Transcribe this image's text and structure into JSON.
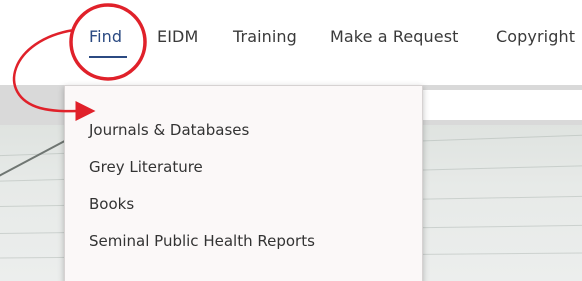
{
  "nav": {
    "items": [
      {
        "label": "Find",
        "active": true
      },
      {
        "label": "EIDM",
        "active": false
      },
      {
        "label": "Training",
        "active": false
      },
      {
        "label": "Make a Request",
        "active": false
      },
      {
        "label": "Copyright",
        "active": false
      }
    ]
  },
  "dropdown": {
    "items": [
      {
        "label": "Journals & Databases"
      },
      {
        "label": "Grey Literature"
      },
      {
        "label": "Books"
      },
      {
        "label": "Seminal Public Health Reports"
      }
    ]
  },
  "colors": {
    "accent": "#2b4a82",
    "annotation": "#e0212a"
  }
}
